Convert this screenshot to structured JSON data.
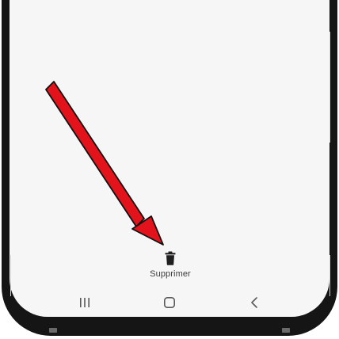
{
  "bottom_action": {
    "icon": "trash-icon",
    "label": "Supprimer"
  },
  "navigation_bar": {
    "buttons": [
      {
        "icon": "recents-icon"
      },
      {
        "icon": "home-icon"
      },
      {
        "icon": "back-icon"
      }
    ]
  },
  "annotation": {
    "arrow_color": "#e3131b"
  }
}
